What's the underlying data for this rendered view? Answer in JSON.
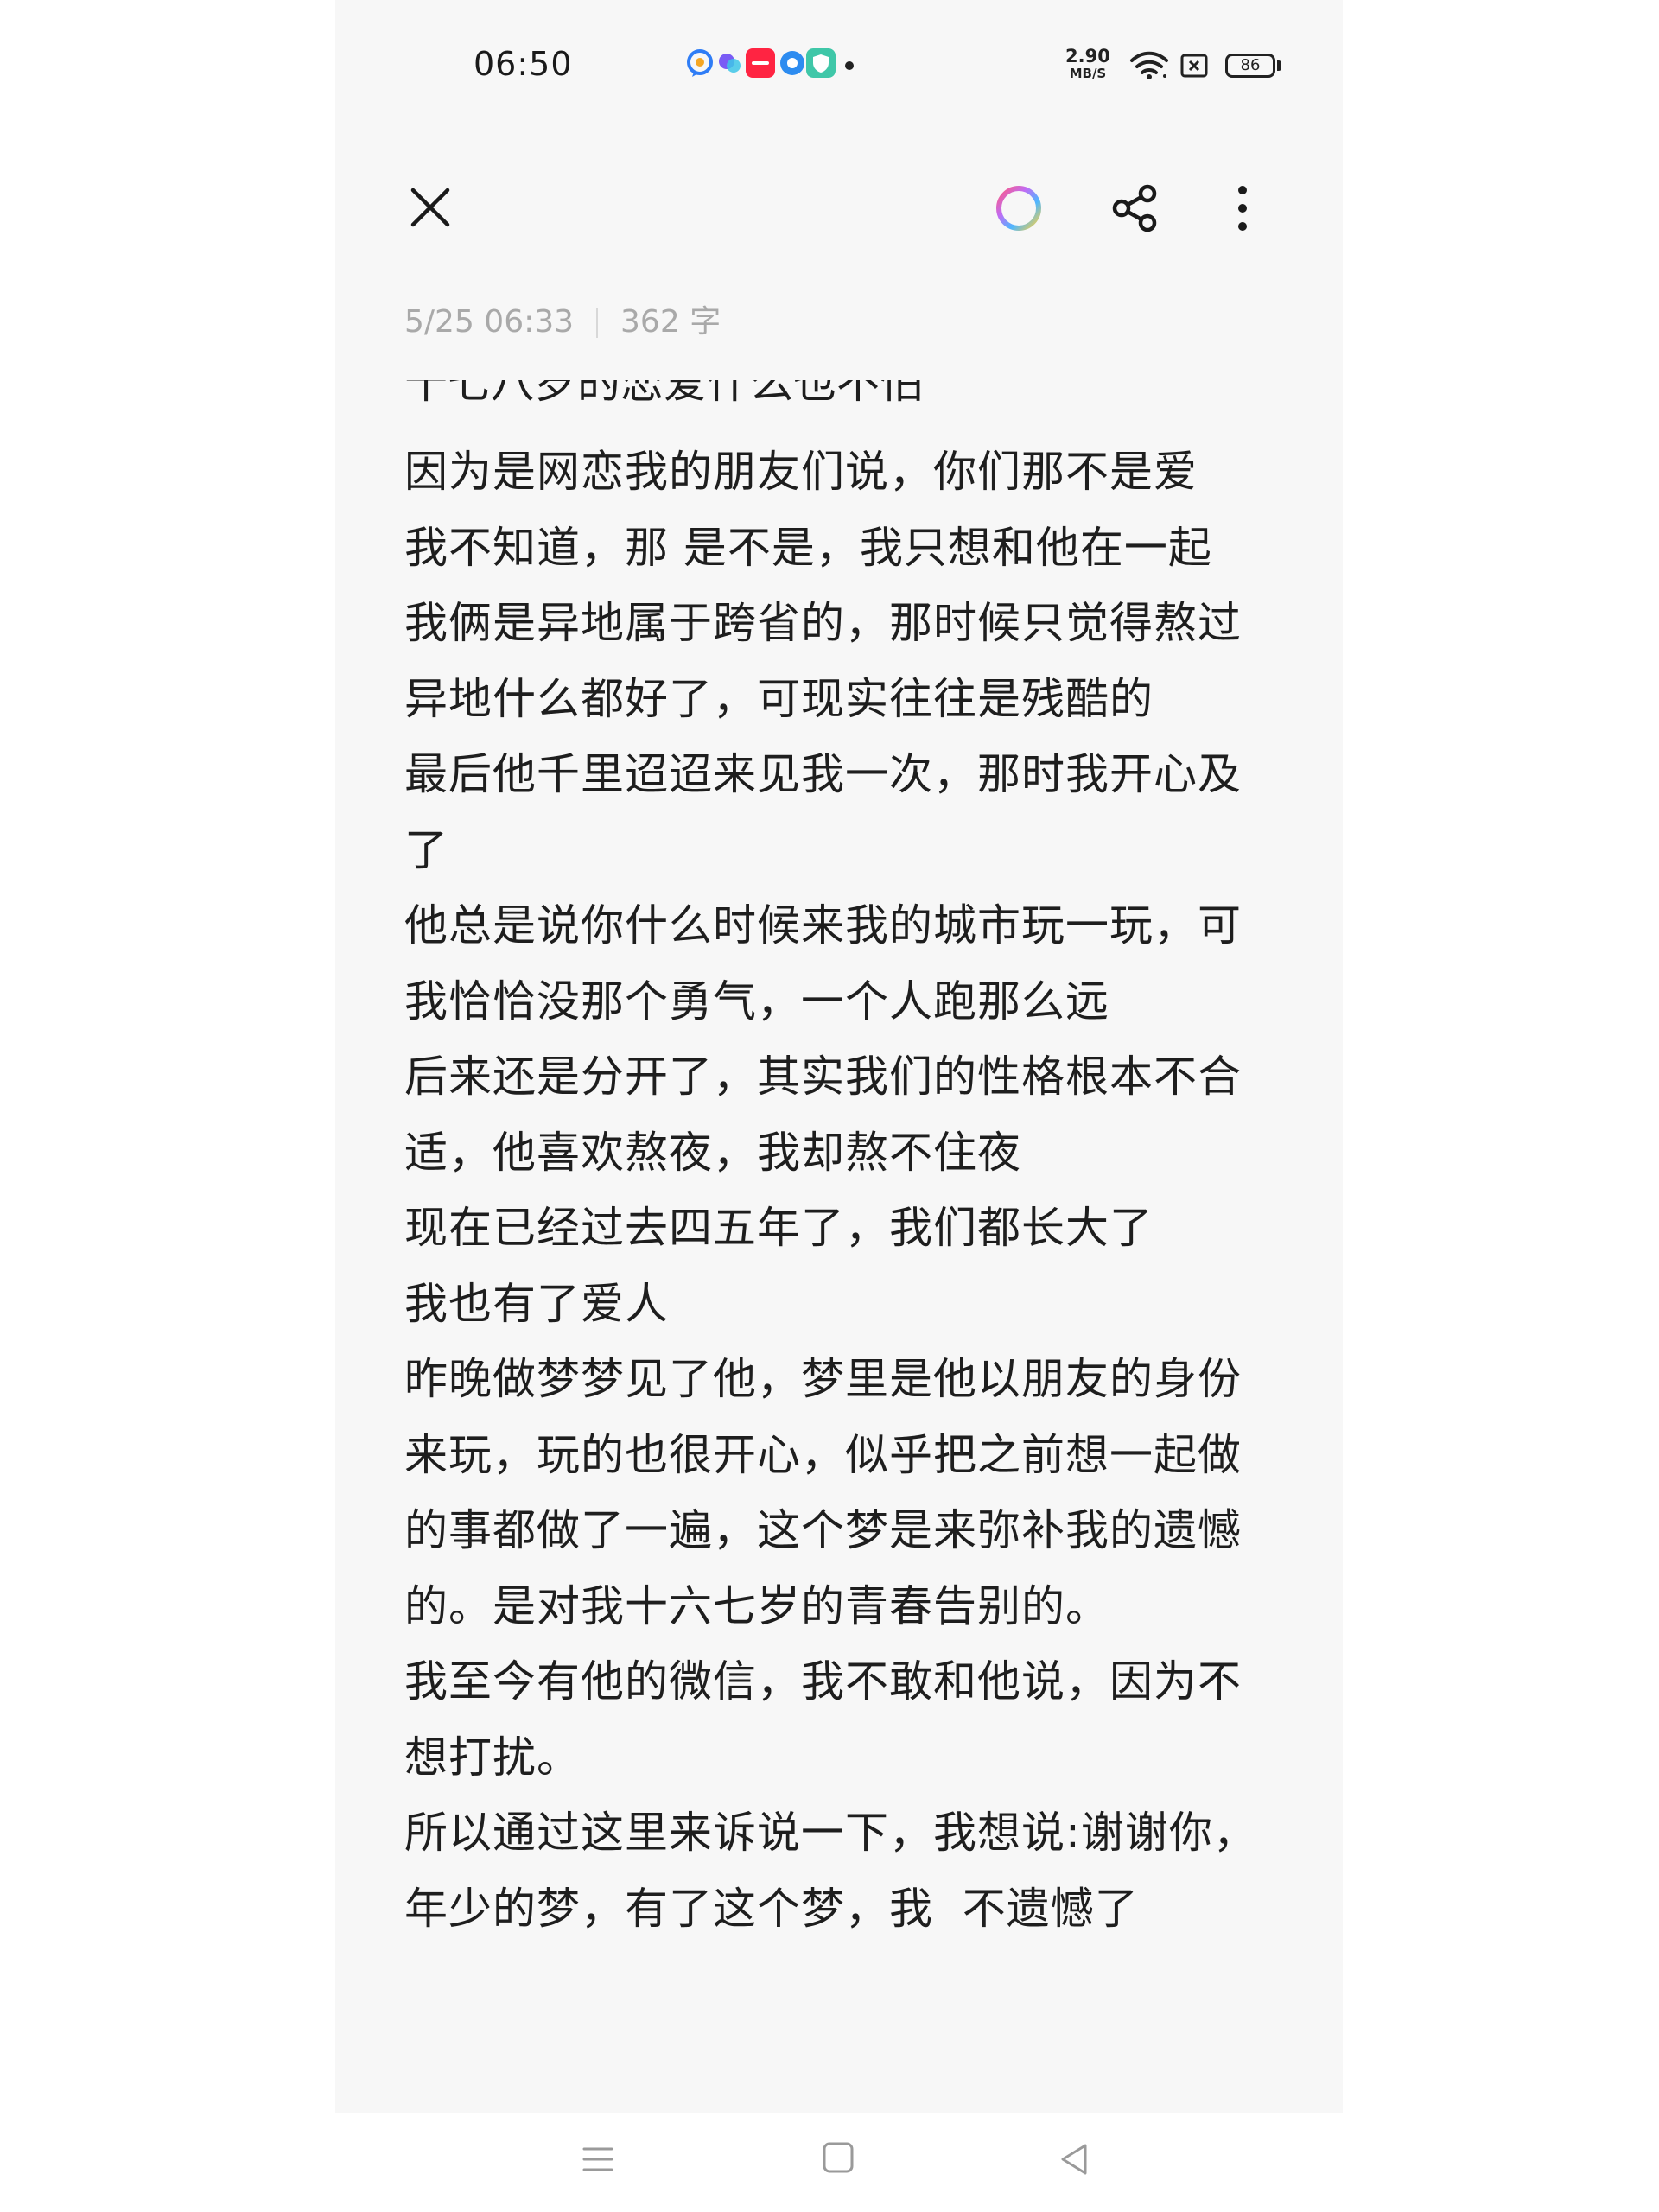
{
  "status_bar": {
    "time": "06:50",
    "net_speed_value": "2.90",
    "net_speed_unit": "MB/S",
    "battery": "86",
    "app_icons": [
      {
        "name": "msg-app-icon",
        "color": "#2f7df6"
      },
      {
        "name": "ai-app-icon",
        "color": "#7a5cf5"
      },
      {
        "name": "xiaohongshu-icon",
        "color": "#ff2442",
        "label": "小红书"
      },
      {
        "name": "browser-app-icon",
        "color": "#2d8cf0"
      },
      {
        "name": "security-app-icon",
        "color": "#3fc7a8"
      }
    ]
  },
  "toolbar": {
    "close_icon": "close-icon",
    "color_icon": "color-ring-icon",
    "share_icon": "share-icon",
    "more_icon": "more-vertical-icon"
  },
  "meta": {
    "datetime": "5/25 06:33",
    "word_count": "362 字"
  },
  "note": {
    "cut_line": "十七八岁的恋爱什么也不怕",
    "lines": [
      "因为是网恋我的朋友们说，你们那不是爱",
      "我不知道，那 是不是，我只想和他在一起",
      "我俩是异地属于跨省的，那时候只觉得熬过",
      "异地什么都好了，可现实往往是残酷的",
      "最后他千里迢迢来见我一次，那时我开心及",
      "了",
      "他总是说你什么时候来我的城市玩一玩，可",
      "我恰恰没那个勇气，一个人跑那么远",
      "后来还是分开了，其实我们的性格根本不合",
      "适，他喜欢熬夜，我却熬不住夜",
      "现在已经过去四五年了，我们都长大了",
      "我也有了爱人",
      "昨晚做梦梦见了他，梦里是他以朋友的身份",
      "来玩，玩的也很开心，似乎把之前想一起做",
      "的事都做了一遍，这个梦是来弥补我的遗憾",
      "的。是对我十六七岁的青春告别的。",
      "我至今有他的微信，我不敢和他说，因为不",
      "想打扰。",
      "所以通过这里来诉说一下，我想说:谢谢你，",
      "年少的梦，有了这个梦，我  不遗憾了"
    ]
  },
  "navbar": {
    "menu_icon": "menu-icon",
    "home_icon": "home-icon",
    "back_icon": "back-icon"
  }
}
